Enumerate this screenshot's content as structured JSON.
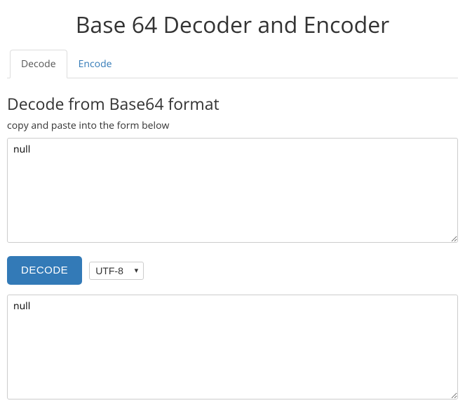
{
  "pageTitle": "Base 64 Decoder and Encoder",
  "tabs": {
    "decode": "Decode",
    "encode": "Encode"
  },
  "heading": "Decode from Base64 format",
  "instruction": "copy and paste into the form below",
  "inputValue": "null",
  "buttonLabel": "DECODE",
  "charsetSelected": "UTF-8",
  "outputValue": "null"
}
